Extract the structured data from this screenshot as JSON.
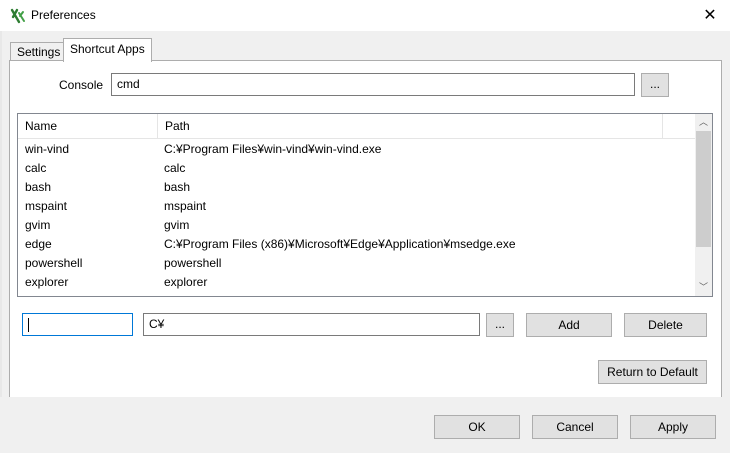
{
  "window": {
    "title": "Preferences",
    "close_glyph": "✕"
  },
  "tabs": [
    {
      "label": "Settings",
      "active": false
    },
    {
      "label": "Shortcut Apps",
      "active": true
    }
  ],
  "console": {
    "label": "Console",
    "value": "cmd",
    "browse_label": "..."
  },
  "list": {
    "headers": {
      "name": "Name",
      "path": "Path"
    },
    "rows": [
      {
        "name": "win-vind",
        "path": "C:¥Program Files¥win-vind¥win-vind.exe"
      },
      {
        "name": "calc",
        "path": "calc"
      },
      {
        "name": "bash",
        "path": "bash"
      },
      {
        "name": "mspaint",
        "path": "mspaint"
      },
      {
        "name": "gvim",
        "path": "gvim"
      },
      {
        "name": "edge",
        "path": "C:¥Program Files (x86)¥Microsoft¥Edge¥Application¥msedge.exe"
      },
      {
        "name": "powershell",
        "path": "powershell"
      },
      {
        "name": "explorer",
        "path": "explorer"
      }
    ]
  },
  "entry": {
    "name_value": "",
    "path_value": "C¥",
    "browse_label": "...",
    "add_label": "Add",
    "delete_label": "Delete"
  },
  "return_default_label": "Return to Default",
  "footer": {
    "ok_label": "OK",
    "cancel_label": "Cancel",
    "apply_label": "Apply"
  }
}
